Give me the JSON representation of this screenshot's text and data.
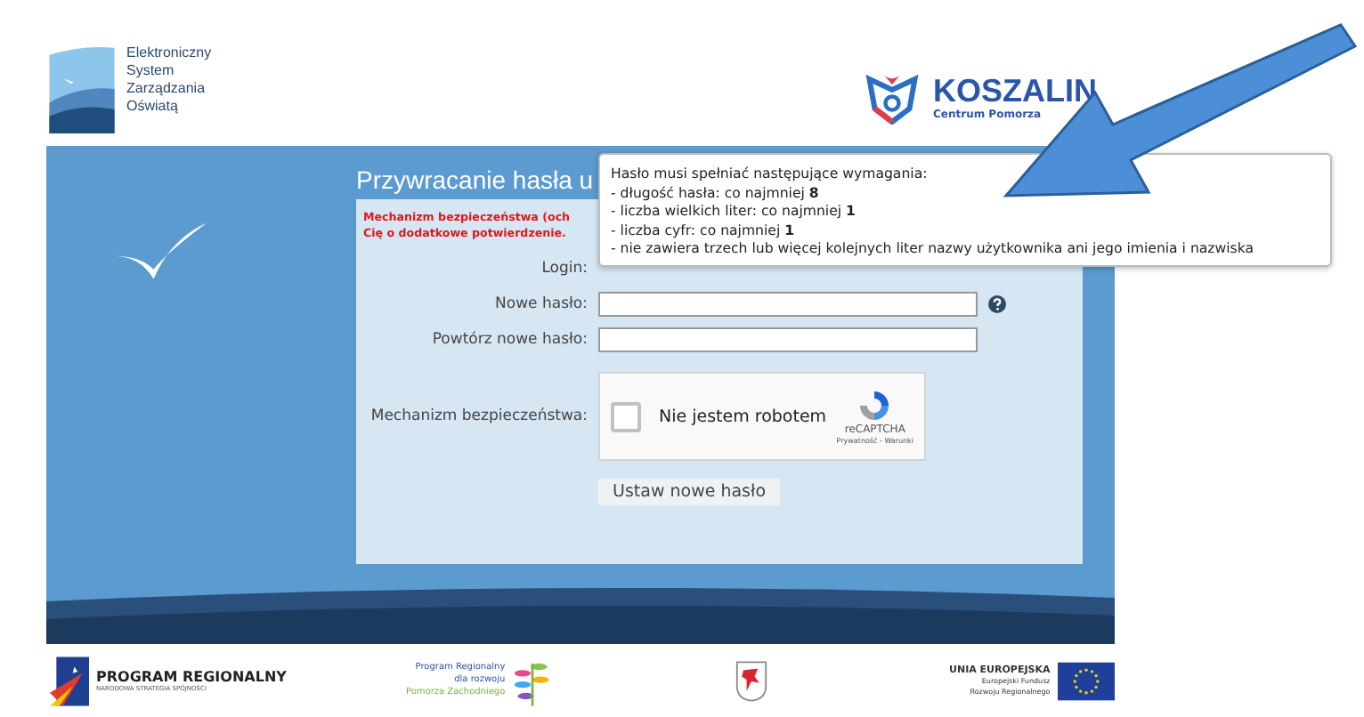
{
  "header": {
    "system_logo_lines": [
      "Elektroniczny",
      "System",
      "Zarządzania",
      "Oświatą"
    ],
    "city_logo": {
      "name": "KOSZALIN",
      "tagline": "Centrum Pomorza"
    }
  },
  "page_title": "Przywracanie hasła u",
  "warning_lines": [
    "Mechanizm bezpieczeństwa (och",
    "Cię o dodatkowe potwierdzenie."
  ],
  "form": {
    "fields": [
      {
        "label": "Login:",
        "kind": "hidden"
      },
      {
        "label": "Nowe hasło:",
        "kind": "password",
        "help": true
      },
      {
        "label": "Powtórz nowe hasło:",
        "kind": "password",
        "help": false
      }
    ],
    "captcha": {
      "label": "Mechanizm bezpieczeństwa:",
      "checkbox_text": "Nie jestem robotem",
      "checked": false,
      "brand": "reCAPTCHA",
      "links": "Prywatność - Warunki"
    },
    "submit": "Ustaw nowe hasło"
  },
  "tooltip": {
    "lines": [
      "Hasło musi spełniać następujące wymagania:",
      "- długość hasła: co najmniej **8**",
      "- liczba wielkich liter: co najmniej **1**",
      "- liczba cyfr: co najmniej **1**",
      "- nie zawiera trzech lub więcej kolejnych liter nazwy użytkownika ani jego imienia i nazwiska"
    ]
  },
  "footer": {
    "logos": [
      {
        "kind": "program",
        "lines": [
          "PROGRAM REGIONALNY",
          "NARODOWA STRATEGIA SPÓJNOŚCI"
        ]
      },
      {
        "kind": "pomorze",
        "lines": [
          "Program Regionalny",
          "dla rozwoju",
          "Pomorza Zachodniego"
        ]
      },
      {
        "kind": "crest"
      },
      {
        "kind": "eu",
        "lines": [
          "UNIA EUROPEJSKA",
          "Europejski Fundusz",
          "Rozwoju Regionalnego"
        ]
      }
    ]
  }
}
